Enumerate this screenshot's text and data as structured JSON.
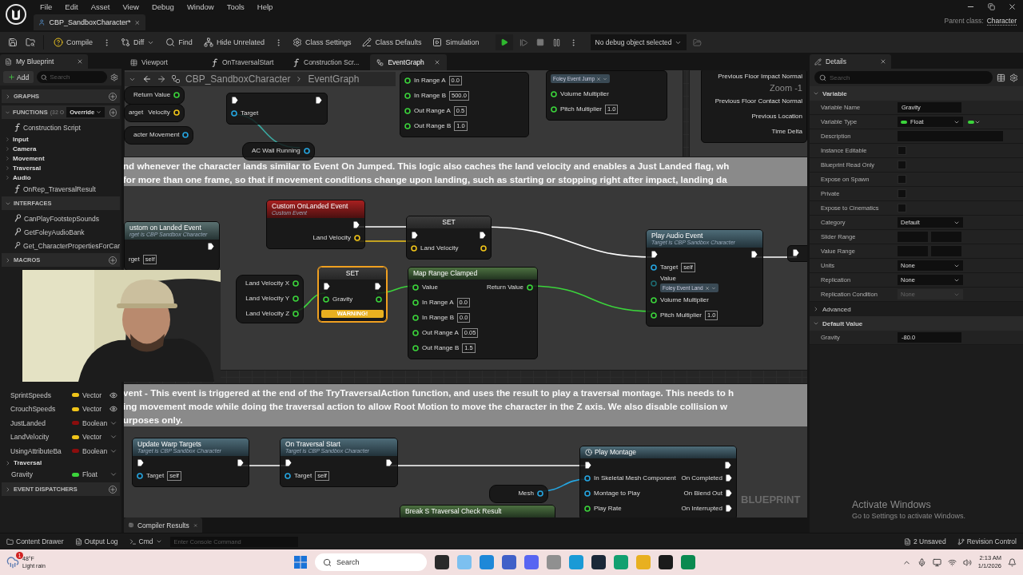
{
  "window": {
    "menu": [
      "File",
      "Edit",
      "Asset",
      "View",
      "Debug",
      "Window",
      "Tools",
      "Help"
    ],
    "document_tab": "CBP_SandboxCharacter*",
    "parent_class_label": "Parent class:",
    "parent_class": "Character"
  },
  "toolbar": {
    "buttons": [
      {
        "label": "Compile",
        "kind": "split"
      },
      {
        "label": "Diff",
        "kind": "dropdown"
      },
      {
        "label": "Find",
        "kind": "plain"
      },
      {
        "label": "Hide Unrelated",
        "kind": "split"
      },
      {
        "label": "Class Settings",
        "kind": "plain"
      },
      {
        "label": "Class Defaults",
        "kind": "plain"
      },
      {
        "label": "Simulation",
        "kind": "plain"
      }
    ],
    "debug_object": "No debug object selected"
  },
  "my_blueprint": {
    "tab": "My Blueprint",
    "add": "Add",
    "search_placeholder": "Search",
    "sections_top": [
      {
        "title": "GRAPHS",
        "expanded": false,
        "add_button": true
      },
      {
        "title": "FUNCTIONS",
        "count": "(32 O",
        "override": "Override",
        "expanded": true,
        "add_button": true,
        "items": [
          {
            "label": "Construction Script",
            "kind": "function"
          },
          {
            "label": "Input",
            "kind": "category"
          },
          {
            "label": "Camera",
            "kind": "category"
          },
          {
            "label": "Movement",
            "kind": "category"
          },
          {
            "label": "Traversal",
            "kind": "category"
          },
          {
            "label": "Audio",
            "kind": "category"
          },
          {
            "label": "OnRep_TraversalResult",
            "kind": "function"
          }
        ]
      },
      {
        "title": "INTERFACES",
        "expanded": true,
        "add_button": false,
        "items": [
          {
            "label": "CanPlayFootstepSounds",
            "kind": "interface"
          },
          {
            "label": "GetFoleyAudioBank",
            "kind": "interface"
          },
          {
            "label": "Get_CharacterPropertiesForCar",
            "kind": "interface"
          }
        ]
      },
      {
        "title": "MACROS",
        "expanded": false,
        "add_button": true
      }
    ],
    "variables": [
      {
        "kind": "group",
        "children": [
          {
            "kind": "variable",
            "label": "SprintSpeeds",
            "type": "Vector",
            "color": "#f0c419",
            "public": true
          },
          {
            "kind": "variable",
            "label": "CrouchSpeeds",
            "type": "Vector",
            "color": "#f0c419",
            "public": true
          },
          {
            "kind": "variable",
            "label": "JustLanded",
            "type": "Boolean",
            "color": "#8c0d0d",
            "public": false
          },
          {
            "kind": "variable",
            "label": "LandVelocity",
            "type": "Vector",
            "color": "#f0c419",
            "public": false
          },
          {
            "kind": "variable",
            "label": "UsingAttributeBa",
            "type": "Boolean",
            "color": "#8c0d0d",
            "public": false
          }
        ]
      },
      {
        "kind": "category",
        "label": "Traversal",
        "expanded": false
      },
      {
        "kind": "variable",
        "label": "Gravity",
        "type": "Float",
        "color": "#3bd43b",
        "public": false
      }
    ],
    "sections_bottom": [
      {
        "title": "EVENT DISPATCHERS",
        "expanded": false,
        "add_button": true
      }
    ]
  },
  "graph": {
    "tabs": [
      {
        "label": "Viewport",
        "selected": false
      },
      {
        "label": "OnTraversalStart",
        "selected": false
      },
      {
        "label": "Construction Scr...",
        "selected": false
      },
      {
        "label": "EventGraph",
        "selected": true
      }
    ],
    "breadcrumb": [
      "CBP_SandboxCharacter",
      "EventGraph"
    ],
    "zoom": "Zoom -1",
    "watermark": "BLUEPRINT",
    "comments": [
      {
        "lines": [
          "nd whenever the character lands similar to Event On Jumped. This logic also caches the land velocity and enables a Just Landed flag, wh",
          "for more than one frame, so that if movement conditions change upon landing, such as starting or stopping right after impact, landing da"
        ]
      },
      {
        "lines": [
          "vent - This event is triggered at the end of the TryTraversalAction function, and uses the result to play a traversal montage. This needs to h",
          "ing movement mode while doing the traversal action to allow Root Motion to move the character in the Z axis. We also disable collision w",
          "urposes only."
        ]
      }
    ],
    "nodes": [
      {
        "kind": "pure",
        "selected": false,
        "outputs": [
          {
            "label": "Return Value",
            "kind": "float"
          }
        ]
      },
      {
        "kind": "pure",
        "selected": false,
        "inputs": [
          {
            "label": "arget",
            "kind": "none"
          }
        ],
        "outputs": [
          {
            "label": "Velocity",
            "kind": "vector"
          }
        ]
      },
      {
        "kind": "pure",
        "selected": false,
        "outputs": [
          {
            "label": "acter Movement",
            "kind": "object"
          }
        ]
      },
      {
        "kind": "function",
        "selected": false,
        "exec_in": true,
        "exec_out": true,
        "inputs": [
          {
            "label": "Target",
            "kind": "object"
          }
        ]
      },
      {
        "kind": "pure",
        "selected": false,
        "outputs": [
          {
            "label": "AC Wall Running",
            "kind": "object"
          }
        ]
      },
      {
        "kind": "function",
        "selected": false,
        "inputs": [
          {
            "label": "In Range A",
            "kind": "float",
            "value": "0.0"
          },
          {
            "label": "In Range B",
            "kind": "float",
            "value": "500.0"
          },
          {
            "label": "Out Range A",
            "kind": "float",
            "value": "0.5"
          },
          {
            "label": "Out Range B",
            "kind": "float",
            "value": "1.0"
          }
        ]
      },
      {
        "kind": "function",
        "selected": false,
        "inputs": [
          {
            "kind": "none",
            "chip": "Foley Event Jump"
          },
          {
            "label": "Volume Multiplier",
            "kind": "float"
          },
          {
            "label": "Pitch Multiplier",
            "kind": "float",
            "value": "1.0"
          }
        ]
      },
      {
        "kind": "function",
        "selected": false,
        "outputs": [
          {
            "label": "Previous Floor Impact Normal",
            "kind": "none"
          },
          {
            "label": "Previous Floor Contact Normal",
            "kind": "none"
          },
          {
            "label": "Previous Location",
            "kind": "none"
          },
          {
            "label": "Time Delta",
            "kind": "none"
          }
        ]
      },
      {
        "kind": "event",
        "selected": false,
        "title": "ustom on Landed Event",
        "subtitle": "rget is CBP Sandbox Character",
        "exec_out": true,
        "inputs": [
          {
            "label": "rget",
            "kind": "none",
            "value": "self"
          }
        ]
      },
      {
        "kind": "custom_event",
        "selected": false,
        "title": "Custom OnLanded Event",
        "subtitle": "Custom Event",
        "exec_out": true,
        "outputs": [
          {
            "label": "Land Velocity",
            "kind": "vector"
          }
        ]
      },
      {
        "kind": "set",
        "selected": false,
        "title": "SET",
        "exec_in": true,
        "exec_out": true,
        "inputs": [
          {
            "label": "Land Velocity",
            "kind": "vector"
          }
        ],
        "outputs": [
          {
            "kind": "vector"
          }
        ]
      },
      {
        "kind": "pure",
        "selected": false,
        "outputs": [
          {
            "label": "Land Velocity X",
            "kind": "float"
          },
          {
            "label": "Land Velocity Y",
            "kind": "float"
          },
          {
            "label": "Land Velocity Z",
            "kind": "float"
          }
        ]
      },
      {
        "kind": "set",
        "selected": true,
        "title": "SET",
        "exec_in": true,
        "exec_out": true,
        "warning": "WARNING!",
        "inputs": [
          {
            "label": "Gravity",
            "kind": "float"
          }
        ],
        "outputs": [
          {
            "kind": "float"
          }
        ]
      },
      {
        "kind": "pure_function",
        "selected": false,
        "title": "Map Range Clamped",
        "inputs": [
          {
            "label": "Value",
            "kind": "float"
          },
          {
            "label": "In Range A",
            "kind": "float",
            "value": "0.0"
          },
          {
            "label": "In Range B",
            "kind": "float",
            "value": "0.0"
          },
          {
            "label": "Out Range A",
            "kind": "float",
            "value": "0.05"
          },
          {
            "label": "Out Range B",
            "kind": "float",
            "value": "1.5"
          }
        ],
        "outputs": [
          {
            "label": "Return Value",
            "kind": "float"
          }
        ]
      },
      {
        "kind": "function",
        "selected": false,
        "title": "Play Audio Event",
        "subtitle": "Target is CBP Sandbox Character",
        "exec_in": true,
        "exec_out": true,
        "inputs": [
          {
            "label": "Target",
            "kind": "object",
            "value": "self"
          },
          {
            "label": "Value",
            "kind": "enum",
            "chip": "Foley Event Land"
          },
          {
            "label": "Volume Multiplier",
            "kind": "float"
          },
          {
            "label": "Pitch Multiplier",
            "kind": "float",
            "value": "1.0"
          }
        ]
      },
      {
        "kind": "function",
        "selected": false,
        "exec_in": true
      },
      {
        "kind": "function",
        "selected": false,
        "title": "Update Warp Targets",
        "subtitle": "Target is CBP Sandbox Character",
        "exec_in": true,
        "exec_out": true,
        "inputs": [
          {
            "label": "Target",
            "kind": "object",
            "value": "self"
          }
        ]
      },
      {
        "kind": "function",
        "selected": false,
        "title": "On Traversal Start",
        "subtitle": "Target is CBP Sandbox Character",
        "exec_in": true,
        "exec_out": true,
        "inputs": [
          {
            "label": "Target",
            "kind": "object",
            "value": "self"
          }
        ]
      },
      {
        "kind": "pure",
        "selected": false,
        "outputs": [
          {
            "label": "Mesh",
            "kind": "object"
          }
        ]
      },
      {
        "kind": "pure_function",
        "selected": false,
        "title": "Break S Traversal Check Result"
      },
      {
        "kind": "latent_function",
        "selected": false,
        "title": "Play Montage",
        "exec_in": true,
        "exec_out": true,
        "inputs": [
          {
            "label": "In Skeletal Mesh Component",
            "kind": "object"
          },
          {
            "label": "Montage to Play",
            "kind": "object"
          },
          {
            "label": "Play Rate",
            "kind": "float"
          }
        ],
        "outputs": [
          {
            "label": "On Completed",
            "kind": "exec"
          },
          {
            "label": "On Blend Out",
            "kind": "exec"
          },
          {
            "label": "On Interrupted",
            "kind": "exec"
          }
        ]
      }
    ],
    "bottom_tab": "Compiler Results"
  },
  "details": {
    "tab": "Details",
    "search_placeholder": "Search",
    "sections": [
      {
        "kind": "section",
        "title": "Variable",
        "expanded": true,
        "rows": [
          {
            "label": "Variable Name",
            "kind": "text",
            "value": "Gravity"
          },
          {
            "label": "Variable Type",
            "kind": "type",
            "value": "Float"
          },
          {
            "label": "Description",
            "kind": "textarea"
          },
          {
            "label": "Instance Editable",
            "kind": "checkbox",
            "checked": false
          },
          {
            "label": "Blueprint Read Only",
            "kind": "checkbox",
            "checked": false
          },
          {
            "label": "Expose on Spawn",
            "kind": "checkbox",
            "checked": false
          },
          {
            "label": "Private",
            "kind": "checkbox",
            "checked": false
          },
          {
            "label": "Expose to Cinematics",
            "kind": "checkbox",
            "checked": false
          },
          {
            "label": "Category",
            "kind": "combo",
            "value": "Default"
          },
          {
            "label": "Slider Range",
            "kind": "range"
          },
          {
            "label": "Value Range",
            "kind": "range"
          },
          {
            "label": "Units",
            "kind": "dropdown",
            "value": "None",
            "disabled": false
          },
          {
            "label": "Replication",
            "kind": "dropdown",
            "value": "None",
            "disabled": false
          },
          {
            "label": "Replication Condition",
            "kind": "dropdown",
            "value": "None",
            "disabled": true
          }
        ]
      },
      {
        "kind": "subsection",
        "title": "Advanced",
        "expanded": false
      },
      {
        "kind": "section",
        "title": "Default Value",
        "expanded": true,
        "rows": [
          {
            "label": "Gravity",
            "kind": "text",
            "value": "-80.0"
          }
        ]
      }
    ]
  },
  "activation": {
    "title": "Activate Windows",
    "subtitle": "Go to Settings to activate Windows."
  },
  "status_bar": {
    "left": [
      {
        "label": "Content Drawer",
        "kind": "button"
      },
      {
        "label": "Output Log",
        "kind": "button"
      },
      {
        "label": "Cmd",
        "kind": "dropdown"
      }
    ],
    "console_placeholder": "Enter Console Command",
    "right": [
      "2 Unsaved",
      "Revision Control"
    ]
  },
  "taskbar": {
    "weather": {
      "temp": "48°F",
      "condition": "Light rain",
      "badge": "1"
    },
    "search_placeholder": "Search",
    "time": "2:13 AM",
    "date": "1/1/2026"
  }
}
